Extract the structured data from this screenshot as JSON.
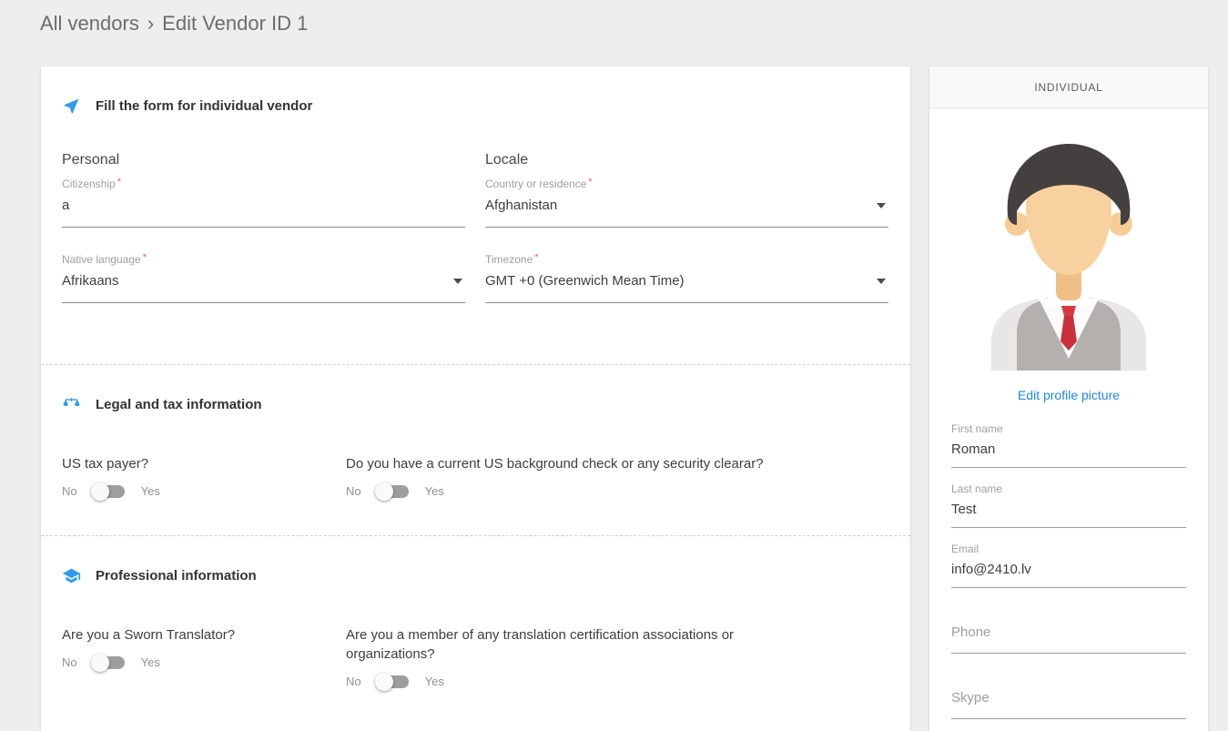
{
  "breadcrumb": {
    "parent": "All vendors",
    "separator": "›",
    "current": "Edit Vendor ID 1"
  },
  "form": {
    "header": {
      "title": "Fill the form for individual vendor",
      "icon": "paper-plane-icon"
    },
    "personal": {
      "group_label": "Personal",
      "citizenship": {
        "label": "Citizenship",
        "required": "*",
        "value": "a"
      },
      "native_language": {
        "label": "Native language",
        "required": "*",
        "value": "Afrikaans"
      }
    },
    "locale": {
      "group_label": "Locale",
      "country": {
        "label": "Country or residence",
        "required": "*",
        "value": "Afghanistan"
      },
      "timezone": {
        "label": "Timezone",
        "required": "*",
        "value": "GMT +0 (Greenwich Mean Time)"
      }
    },
    "legal": {
      "title": "Legal and tax information",
      "icon": "scales-icon",
      "questions": [
        {
          "question": "US tax payer?",
          "no": "No",
          "yes": "Yes",
          "value": "No"
        },
        {
          "question": "Do you have a current US background check or any security clearar?",
          "no": "No",
          "yes": "Yes",
          "value": "No"
        }
      ]
    },
    "professional": {
      "title": "Professional information",
      "icon": "graduation-cap-icon",
      "questions": [
        {
          "question": "Are you a Sworn Translator?",
          "no": "No",
          "yes": "Yes",
          "value": "No"
        },
        {
          "question": "Are you a member of any translation certification associations or organizations?",
          "no": "No",
          "yes": "Yes",
          "value": "No"
        }
      ]
    }
  },
  "sidebar": {
    "header": "INDIVIDUAL",
    "avatar": "male-person-avatar",
    "edit_link": "Edit profile picture",
    "fields": [
      {
        "label": "First name",
        "value": "Roman"
      },
      {
        "label": "Last name",
        "value": "Test"
      },
      {
        "label": "Email",
        "value": "info@2410.lv"
      },
      {
        "label": "Phone",
        "value": ""
      },
      {
        "label": "Skype",
        "value": ""
      }
    ]
  },
  "colors": {
    "accent_blue": "#2e9bee",
    "link_blue": "#1e88e5",
    "required_red": "#e66060",
    "toggle_track": "#9e9e9e",
    "page_background": "#eeeeee"
  }
}
